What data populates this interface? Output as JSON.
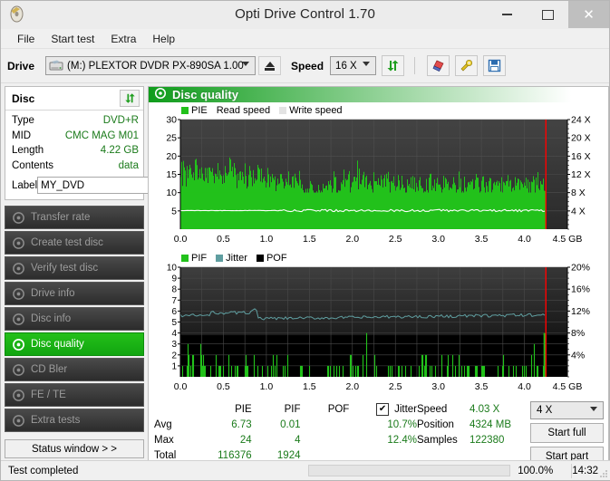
{
  "window": {
    "title": "Opti Drive Control 1.70",
    "icon": "disc-icon",
    "controls": {
      "minimize": "minimize-icon",
      "maximize": "maximize-icon",
      "close": "close-icon"
    }
  },
  "menu": {
    "items": [
      "File",
      "Start test",
      "Extra",
      "Help"
    ]
  },
  "toolbar": {
    "drive_label": "Drive",
    "drive_value": "(M:)   PLEXTOR DVDR   PX-890SA 1.00",
    "eject_icon": "eject-icon",
    "speed_label": "Speed",
    "speed_value": "16 X",
    "buttons": [
      {
        "name": "refresh-icon"
      },
      {
        "name": "eraser-icon"
      },
      {
        "name": "tools-icon"
      },
      {
        "name": "save-icon"
      }
    ]
  },
  "disc_panel": {
    "title": "Disc",
    "refresh_icon": "refresh-icon",
    "rows": [
      {
        "key": "Type",
        "value": "DVD+R"
      },
      {
        "key": "MID",
        "value": "CMC MAG M01"
      },
      {
        "key": "Length",
        "value": "4.22 GB"
      },
      {
        "key": "Contents",
        "value": "data"
      }
    ],
    "label_key": "Label",
    "label_value": "MY_DVD",
    "label_placeholder": "MY_DVD",
    "label_button_icon": "disc-icon"
  },
  "nav": {
    "items": [
      {
        "label": "Transfer rate",
        "active": false
      },
      {
        "label": "Create test disc",
        "active": false
      },
      {
        "label": "Verify test disc",
        "active": false
      },
      {
        "label": "Drive info",
        "active": false
      },
      {
        "label": "Disc info",
        "active": false
      },
      {
        "label": "Disc quality",
        "active": true
      },
      {
        "label": "CD Bler",
        "active": false
      },
      {
        "label": "FE / TE",
        "active": false
      },
      {
        "label": "Extra tests",
        "active": false
      }
    ],
    "status_window_button": "Status window > >"
  },
  "panel": {
    "title": "Disc quality",
    "icon": "disc-quality-icon"
  },
  "chart_data": [
    {
      "type": "bar",
      "name": "pie-chart",
      "title": "PIE",
      "legend": [
        {
          "label": "PIE",
          "color": "#22c11b"
        },
        {
          "label": "Read speed",
          "color": "#ffffff"
        },
        {
          "label": "Write speed",
          "color": "#d8d8d8"
        }
      ],
      "legend_position": "top-left",
      "xlabel": "GB",
      "ylabel": "PIE",
      "y2label": "X",
      "xlim": [
        0,
        4.5
      ],
      "ylim": [
        0,
        30
      ],
      "y2lim": [
        0,
        24
      ],
      "xticks": [
        "0.0",
        "0.5",
        "1.0",
        "1.5",
        "2.0",
        "2.5",
        "3.0",
        "3.5",
        "4.0",
        "4.5 GB"
      ],
      "yticks": [
        30,
        25,
        20,
        15,
        10,
        5
      ],
      "y2ticks": [
        "24 X",
        "20 X",
        "16 X",
        "12 X",
        "8 X",
        "4 X"
      ],
      "grid": true,
      "scan_end_gb": 4.25,
      "marker_color": "#ff0000",
      "envelope_max": [
        18,
        22,
        16,
        19,
        17,
        18,
        20,
        16,
        19,
        18,
        17,
        21,
        19,
        18,
        17,
        19,
        16,
        20,
        18,
        24,
        17,
        19,
        16,
        18,
        17,
        20,
        15,
        18,
        16,
        17,
        19,
        16,
        18,
        15,
        17,
        16,
        18,
        15,
        17,
        18,
        16,
        14,
        17,
        16,
        18,
        15,
        17,
        16,
        13,
        12,
        11,
        14,
        12,
        10,
        13,
        11,
        14,
        12,
        15,
        13,
        16,
        14,
        12,
        15,
        18,
        14,
        16,
        13,
        15,
        23,
        16,
        14,
        17,
        15,
        16,
        14,
        17,
        15,
        16,
        14,
        15,
        17,
        14,
        16,
        13,
        15,
        14,
        16,
        13,
        15,
        14,
        16,
        13,
        15,
        14,
        13,
        15,
        14,
        16,
        13,
        15,
        14,
        13,
        15,
        16,
        14,
        13,
        15,
        14,
        16,
        13,
        15,
        14,
        13,
        15,
        14,
        16,
        13,
        15,
        14,
        13,
        15,
        14,
        16,
        13,
        15,
        14,
        13,
        15,
        14,
        13,
        15,
        14,
        16,
        13,
        15,
        14,
        13,
        15,
        14,
        16,
        13,
        15,
        14
      ],
      "envelope_min": [
        11,
        12,
        10,
        12,
        11,
        12,
        13,
        11,
        12,
        11,
        12,
        13,
        12,
        11,
        12,
        13,
        11,
        12,
        12,
        14,
        11,
        12,
        11,
        12,
        11,
        12,
        10,
        12,
        11,
        12,
        12,
        11,
        12,
        10,
        11,
        11,
        12,
        10,
        11,
        12,
        11,
        10,
        11,
        11,
        12,
        10,
        11,
        11,
        9,
        8,
        8,
        9,
        8,
        8,
        9,
        8,
        9,
        8,
        10,
        9,
        10,
        9,
        8,
        10,
        11,
        9,
        10,
        9,
        10,
        12,
        10,
        9,
        11,
        10,
        11,
        9,
        11,
        10,
        11,
        9,
        10,
        11,
        9,
        11,
        9,
        10,
        9,
        11,
        9,
        10,
        9,
        11,
        9,
        10,
        9,
        9,
        10,
        9,
        11,
        9,
        10,
        9,
        9,
        10,
        11,
        9,
        9,
        10,
        9,
        11,
        9,
        10,
        9,
        9,
        10,
        9,
        11,
        9,
        10,
        9,
        9,
        10,
        9,
        11,
        9,
        10,
        9,
        9,
        10,
        9,
        9,
        10,
        9,
        11,
        9,
        10,
        9,
        9,
        10,
        9,
        11,
        9,
        10,
        9
      ],
      "read_speed_series_label": "Read speed",
      "read_speed_x_value": 4.03
    },
    {
      "type": "bar",
      "name": "pif-jitter-chart",
      "title": "PIF",
      "legend": [
        {
          "label": "PIF",
          "color": "#22c11b"
        },
        {
          "label": "Jitter",
          "color": "#5f9ea0"
        },
        {
          "label": "POF",
          "color": "#000000"
        }
      ],
      "legend_position": "top-left",
      "xlabel": "GB",
      "ylabel": "PIF",
      "y2label": "%",
      "xlim": [
        0,
        4.5
      ],
      "ylim": [
        0,
        10
      ],
      "y2lim": [
        0,
        20
      ],
      "xticks": [
        "0.0",
        "0.5",
        "1.0",
        "1.5",
        "2.0",
        "2.5",
        "3.0",
        "3.5",
        "4.0",
        "4.5 GB"
      ],
      "yticks": [
        10,
        9,
        8,
        7,
        6,
        5,
        4,
        3,
        2,
        1
      ],
      "y2ticks": [
        "20%",
        "16%",
        "12%",
        "8%",
        "4%"
      ],
      "grid": true,
      "scan_end_gb": 4.25,
      "marker_color": "#ff0000",
      "jitter_color": "#5f9ea0",
      "jitter_start_pct": 11.2,
      "jitter_mid_pct": 12.2,
      "jitter_tail_pct": 10.4,
      "pif_spikes_max": 4
    }
  ],
  "stats": {
    "columns": [
      "PIE",
      "PIF",
      "POF",
      "Jitter"
    ],
    "jitter_checked": true,
    "jitter_check_glyph": "✔",
    "rows": [
      {
        "label": "Avg",
        "pie": "6.73",
        "pif": "0.01",
        "pof": "",
        "jitter": "10.7%"
      },
      {
        "label": "Max",
        "pie": "24",
        "pif": "4",
        "pof": "",
        "jitter": "12.4%"
      },
      {
        "label": "Total",
        "pie": "116376",
        "pif": "1924",
        "pof": "",
        "jitter": ""
      }
    ],
    "mid": [
      {
        "key": "Speed",
        "value": "4.03 X"
      },
      {
        "key": "Position",
        "value": "4324 MB"
      },
      {
        "key": "Samples",
        "value": "122380"
      }
    ],
    "speed_select": "4 X",
    "start_full_button": "Start full",
    "start_part_button": "Start part"
  },
  "statusbar": {
    "text": "Test completed",
    "progress_pct": 100.0,
    "progress_label": "100.0%",
    "time": "14:32"
  },
  "colors": {
    "accent_green": "#12a312",
    "value_green": "#1a7a1a",
    "chart_green": "#22c11b",
    "jitter": "#5f9ea0",
    "marker_red": "#ff0000",
    "chart_bg_dark": "#3a3a3a",
    "chart_bg_black": "#000000"
  }
}
